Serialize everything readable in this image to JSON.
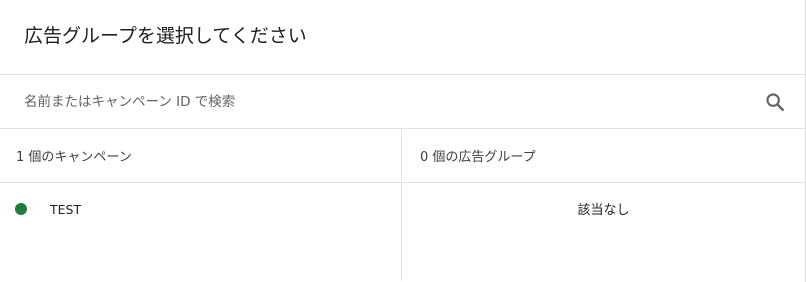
{
  "dialog": {
    "title": "広告グループを選択してください"
  },
  "search": {
    "placeholder": "名前またはキャンペーン ID で検索",
    "value": "",
    "icon": "search-icon"
  },
  "campaigns": {
    "header": "1 個のキャンペーン",
    "items": [
      {
        "label": "TEST",
        "status_color": "#188038"
      }
    ]
  },
  "ad_groups": {
    "header": "0 個の広告グループ",
    "empty_text": "該当なし"
  }
}
